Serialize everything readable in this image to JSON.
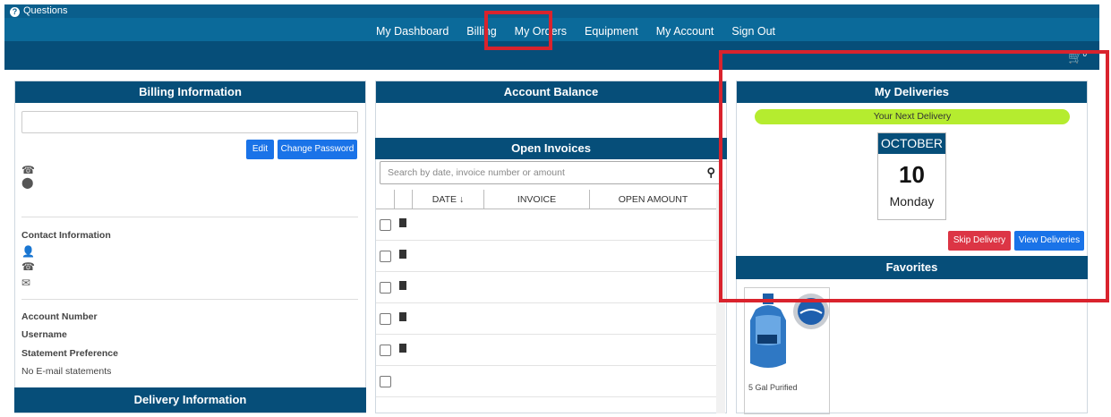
{
  "topbar": {
    "questions": "Questions"
  },
  "nav": [
    "My Dashboard",
    "Billing",
    "My Orders",
    "Equipment",
    "My Account",
    "Sign Out"
  ],
  "cart_count": "0",
  "billing": {
    "header": "Billing Information",
    "edit": "Edit",
    "change_password": "Change Password",
    "contact_label": "Contact Information",
    "account_number": "Account Number",
    "username": "Username",
    "statement_pref": "Statement Preference",
    "statement_value": "No E-mail statements"
  },
  "delivery_info": {
    "header": "Delivery Information"
  },
  "balance": {
    "header": "Account Balance"
  },
  "invoices": {
    "header": "Open Invoices",
    "search_placeholder": "Search by date, invoice number or amount",
    "columns": [
      "DATE ↓",
      "INVOICE",
      "OPEN AMOUNT"
    ]
  },
  "deliveries": {
    "header": "My Deliveries",
    "next": "Your Next Delivery",
    "month": "OCTOBER",
    "day": "10",
    "weekday": "Monday",
    "skip": "Skip Delivery",
    "view": "View Deliveries"
  },
  "favorites": {
    "header": "Favorites",
    "item": "5 Gal Purified"
  },
  "colors": {
    "header": "#064e79",
    "nav": "#0b6a9a",
    "highlight": "#d9232d",
    "pill": "#b5ec2f"
  }
}
